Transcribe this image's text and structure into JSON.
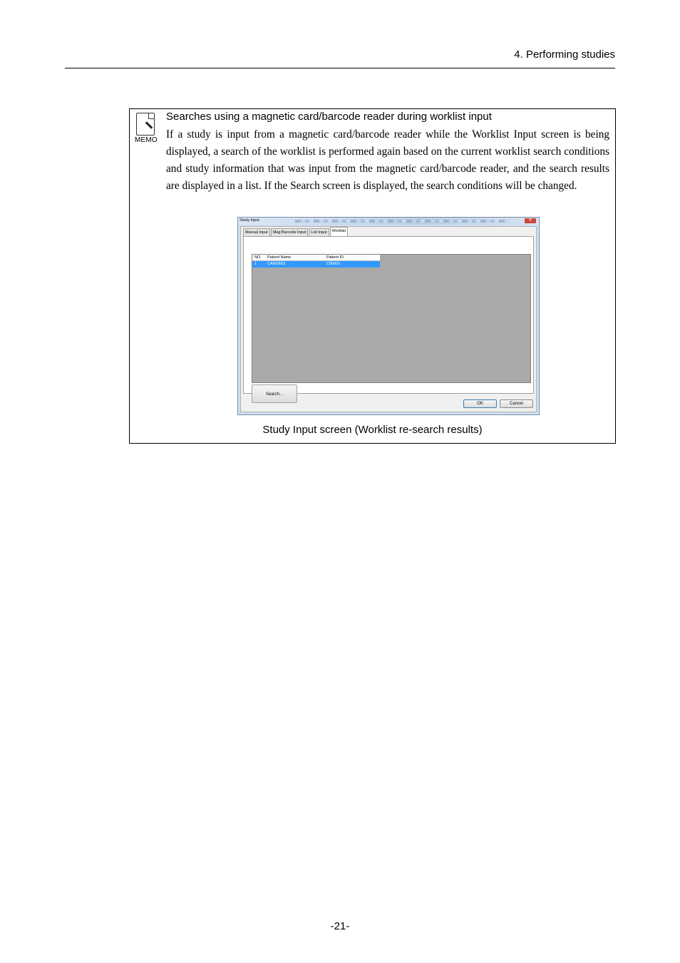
{
  "header": {
    "section_title": "4. Performing studies"
  },
  "memo": {
    "icon_label": "MEMO",
    "icon": "memo-note-icon",
    "heading": "Searches using a magnetic card/barcode reader during worklist input",
    "body": "If a study is input from a magnetic card/barcode reader while the Worklist Input screen is being displayed, a search of the worklist is performed again based on the current worklist search conditions and study information that was input from the magnetic card/barcode reader, and the search results are displayed in a list. If the Search screen is displayed, the search conditions will be changed.",
    "caption": "Study Input screen (Worklist re-search results)"
  },
  "screenshot": {
    "window_title": "Study Input",
    "close_glyph": "✕",
    "tabs": [
      "Manual Input",
      "Mag Barcode Input",
      "List Input",
      "Worklist"
    ],
    "active_tab": "Worklist",
    "columns": [
      "NO.",
      "Patient Name",
      "Patient ID"
    ],
    "rows": [
      {
        "no": "1",
        "name": "CANON01",
        "id": "C00001"
      }
    ],
    "search_button": "Search...",
    "ok_button": "OK",
    "cancel_button": "Cancel",
    "selection_color": "#3399ff"
  },
  "footer": {
    "page_number": "-21-"
  }
}
